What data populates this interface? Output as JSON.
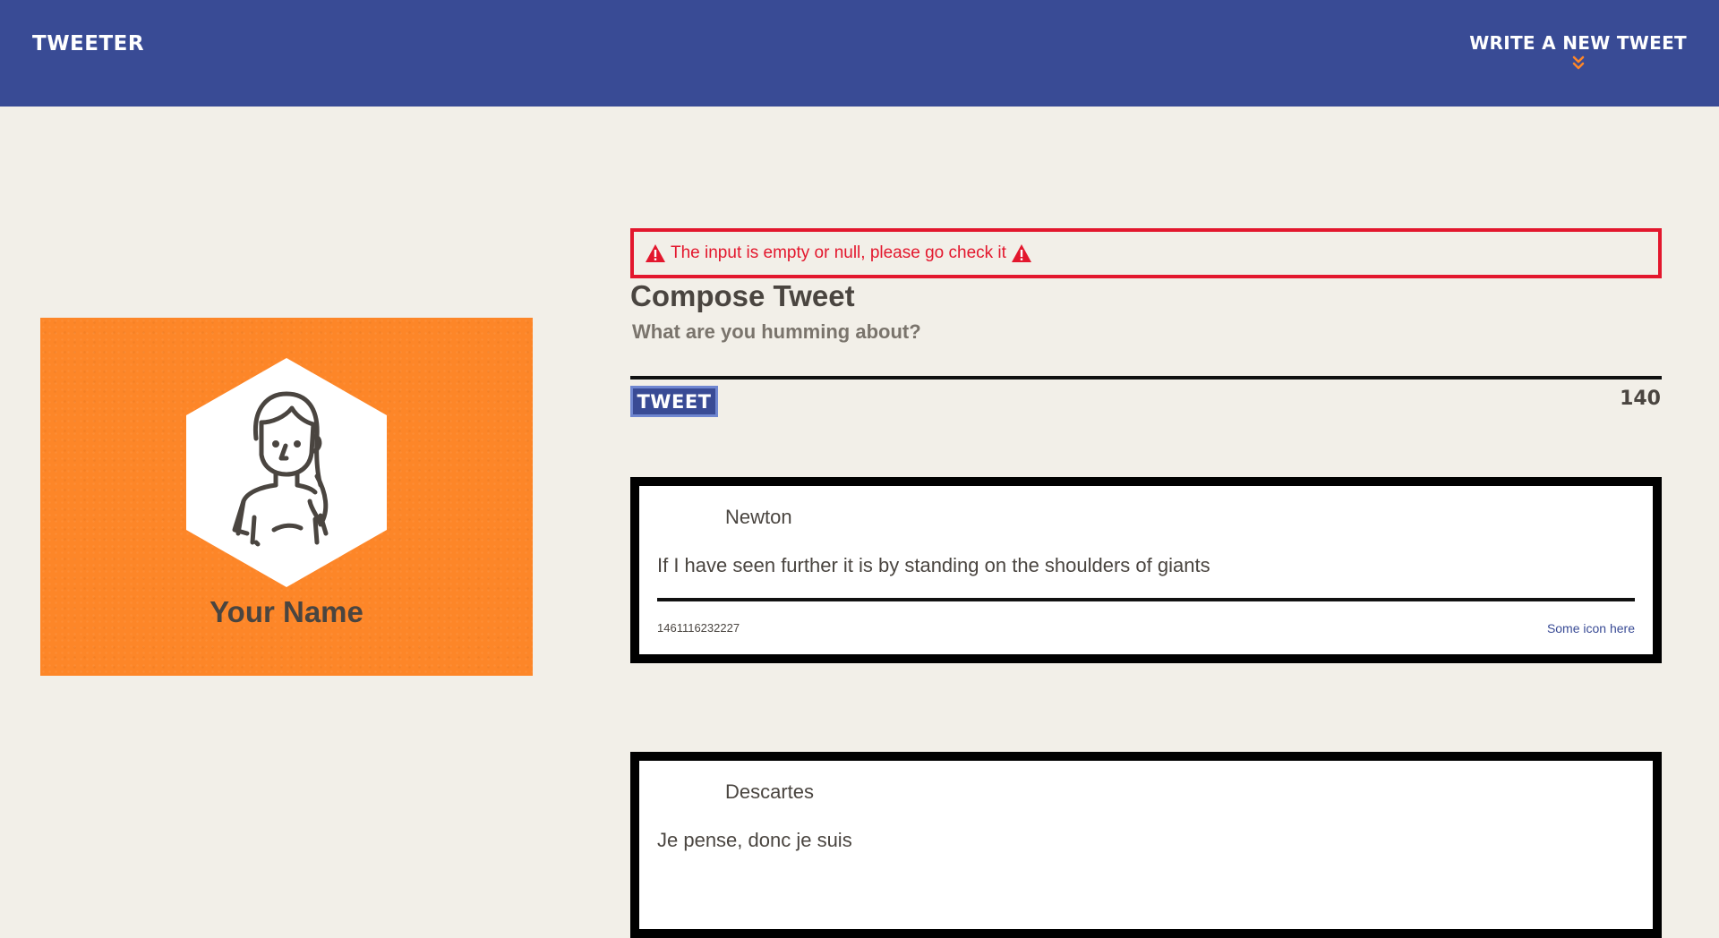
{
  "nav": {
    "brand": "TWEETER",
    "compose_toggle_label": "WRITE A NEW TWEET",
    "chevron_color": "#fd8628"
  },
  "profile": {
    "name": "Your Name",
    "avatar_icon": "woman-avatar-icon",
    "card_color": "#fd8628"
  },
  "compose": {
    "error_message": "The input is empty or null, please go check it",
    "error_icon": "warning-triangle-icon",
    "title": "Compose Tweet",
    "placeholder": "What are you humming about?",
    "button_label": "TWEET",
    "counter": "140"
  },
  "tweets": [
    {
      "author": "Newton",
      "content": "If I have seen further it is by standing on the shoulders of giants",
      "timestamp": "1461116232227",
      "icons_label": "Some icon here"
    },
    {
      "author": "Descartes",
      "content": "Je pense, donc je suis",
      "timestamp": "",
      "icons_label": ""
    }
  ],
  "colors": {
    "nav_bg": "#394b95",
    "page_bg": "#f2efe8",
    "error": "#e3172d",
    "text": "#4a4540"
  }
}
